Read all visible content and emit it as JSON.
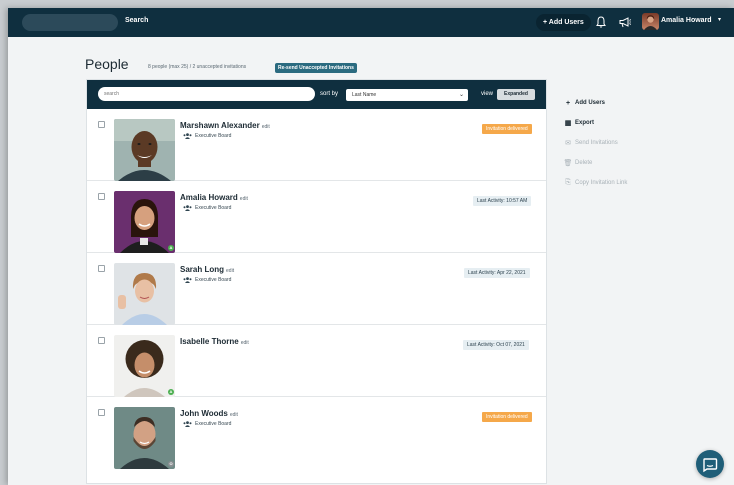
{
  "header": {
    "search_label": "Search",
    "add_users_label": "+ Add Users",
    "user_name": "Amalia Howard",
    "caret": "▾"
  },
  "page": {
    "title": "People",
    "meta": "8 people (max 25)  /  2 unaccepted invitations",
    "resend_label": "Re-send Unaccepted Invitations"
  },
  "filters": {
    "search_placeholder": "search",
    "sort_label": "sort by",
    "sort_value": "Last Name",
    "view_label": "view",
    "view_value": "Expanded"
  },
  "people": [
    {
      "name": "Marshawn Alexander",
      "edit": "edit",
      "group": "Executive Board",
      "status": "Invitation delivered",
      "status_type": "invite",
      "badge": ""
    },
    {
      "name": "Amalia Howard",
      "edit": "edit",
      "group": "Executive Board",
      "status": "Last Activity: 10:57 AM",
      "status_type": "activity",
      "badge": "A"
    },
    {
      "name": "Sarah Long",
      "edit": "edit",
      "group": "Executive Board",
      "status": "Last Activity: Apr 22, 2021",
      "status_type": "activity",
      "badge": ""
    },
    {
      "name": "Isabelle Thorne",
      "edit": "edit",
      "group": "",
      "status": "Last Activity: Oct 07, 2021",
      "status_type": "activity",
      "badge": "A"
    },
    {
      "name": "John Woods",
      "edit": "edit",
      "group": "Executive Board",
      "status": "Invitation delivered",
      "status_type": "invite",
      "badge": "O"
    }
  ],
  "side_actions": [
    {
      "label": "Add Users",
      "icon": "+",
      "enabled": true
    },
    {
      "label": "Export",
      "icon": "▦",
      "enabled": true
    },
    {
      "label": "Send Invitations",
      "icon": "✉",
      "enabled": false
    },
    {
      "label": "Delete",
      "icon": "🗑",
      "enabled": false
    },
    {
      "label": "Copy Invitation Link",
      "icon": "⎘",
      "enabled": false
    }
  ],
  "colors": {
    "topbar": "#0f2f3f",
    "invite_badge": "#f5a84a",
    "accent": "#2b6b80"
  }
}
